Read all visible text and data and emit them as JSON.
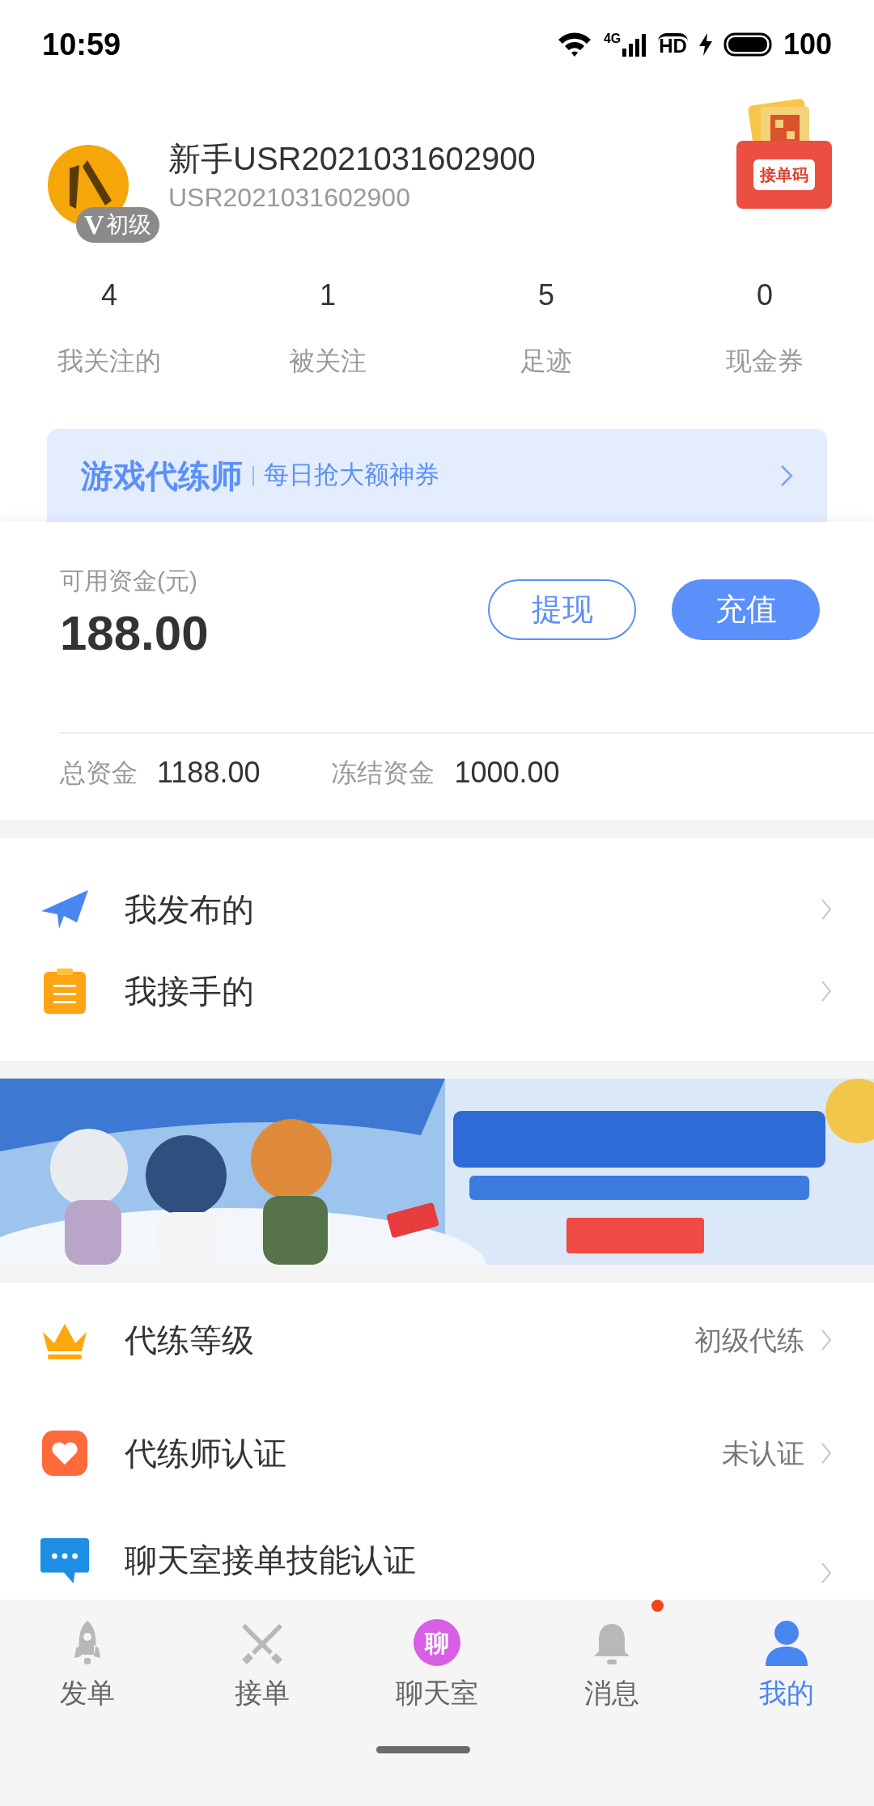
{
  "status_bar": {
    "time": "10:59",
    "network": "4G",
    "hd": "HD",
    "battery": "100"
  },
  "profile": {
    "name": "新手USR2021031602900",
    "user_id": "USR2021031602900",
    "badge_mark": "V",
    "level": "初级",
    "qr_label": "接单码"
  },
  "stats": [
    {
      "value": "4",
      "label": "我关注的"
    },
    {
      "value": "1",
      "label": "被关注"
    },
    {
      "value": "5",
      "label": "足迹"
    },
    {
      "value": "0",
      "label": "现金券"
    }
  ],
  "promo": {
    "title": "游戏代练师",
    "subtitle": "每日抢大额神券"
  },
  "wallet": {
    "available_label": "可用资金(元)",
    "available": "188.00",
    "withdraw": "提现",
    "recharge": "充值",
    "total_label": "总资金",
    "total": "1188.00",
    "frozen_label": "冻结资金",
    "frozen": "1000.00"
  },
  "orders_menu": [
    {
      "label": "我发布的"
    },
    {
      "label": "我接手的"
    }
  ],
  "settings_menu": [
    {
      "label": "代练等级",
      "value": "初级代练"
    },
    {
      "label": "代练师认证",
      "value": "未认证"
    },
    {
      "label": "聊天室接单技能认证"
    }
  ],
  "tabs": [
    {
      "label": "发单",
      "selected": false,
      "unread": false
    },
    {
      "label": "接单",
      "selected": false,
      "unread": false
    },
    {
      "label": "聊天室",
      "selected": false,
      "unread": false,
      "icon_text": "聊"
    },
    {
      "label": "消息",
      "selected": false,
      "unread": true
    },
    {
      "label": "我的",
      "selected": true,
      "unread": false
    }
  ]
}
